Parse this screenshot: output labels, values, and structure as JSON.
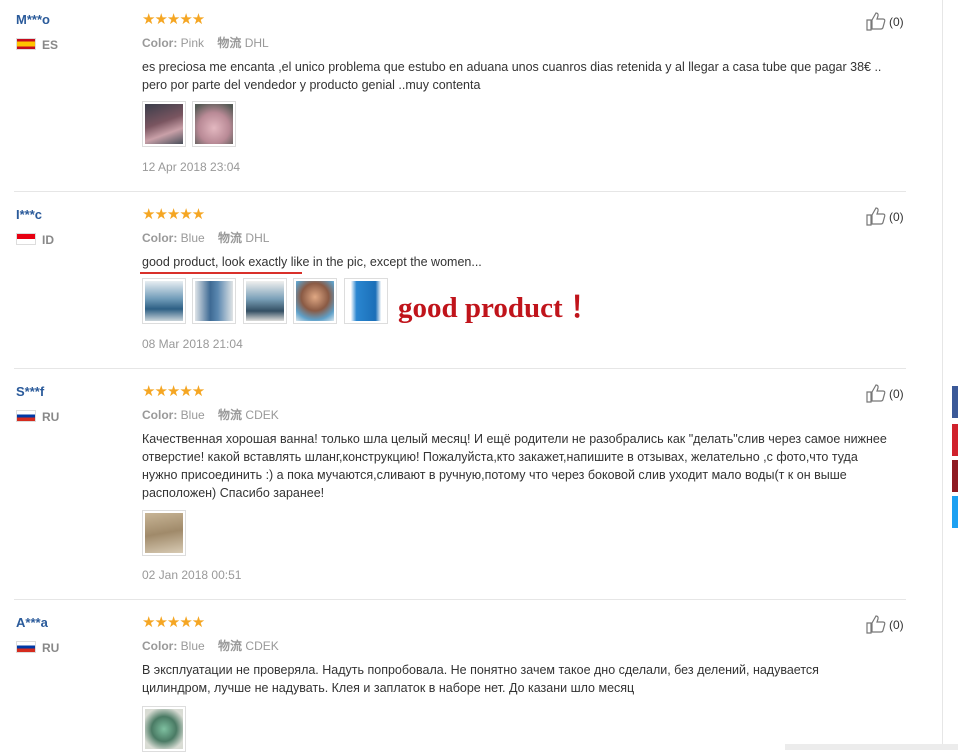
{
  "reviews": [
    {
      "user": "M***o",
      "country": "ES",
      "flag": "es",
      "stars": "★★★★★",
      "color_label": "Color:",
      "color_value": "Pink",
      "logistics_label": "物流",
      "logistics_value": "DHL",
      "text": "es preciosa me encanta ,el unico problema que estubo en aduana unos cuanros dias retenida y al llegar a casa tube que pagar 38€ .. pero por parte del vendedor y producto genial ..muy contenta",
      "helpful_count": "(0)",
      "date": "12 Apr 2018 23:04",
      "photo_count": 2
    },
    {
      "user": "I***c",
      "country": "ID",
      "flag": "id",
      "stars": "★★★★★",
      "color_label": "Color:",
      "color_value": "Blue",
      "logistics_label": "物流",
      "logistics_value": "DHL",
      "text": "good product, look exactly like in the pic, except the women...",
      "helpful_count": "(0)",
      "date": "08 Mar 2018 21:04",
      "photo_count": 5
    },
    {
      "user": "S***f",
      "country": "RU",
      "flag": "ru",
      "stars": "★★★★★",
      "color_label": "Color:",
      "color_value": "Blue",
      "logistics_label": "物流",
      "logistics_value": "CDEK",
      "text": "Качественная хорошая ванна! только шла целый месяц! И ещё родители не разобрались как \"делать\"слив через самое нижнее отверстие! какой вставлять шланг,конструкцию! Пожалуйста,кто закажет,напишите в отзывах, желательно ,с фото,что туда нужно присоединить :) а пока мучаются,сливают в ручную,потому что через боковой слив уходит мало воды(т к он выше расположен) Спасибо заранее!",
      "helpful_count": "(0)",
      "date": "02 Jan 2018 00:51",
      "photo_count": 1
    },
    {
      "user": "A***a",
      "country": "RU",
      "flag": "ru",
      "stars": "★★★★★",
      "color_label": "Color:",
      "color_value": "Blue",
      "logistics_label": "物流",
      "logistics_value": "CDEK",
      "text": "В эксплуатации не проверяла. Надуть попробовала. Не понятно зачем такое дно сделали, без делений, надувается цилиндром, лучше не надувать. Клея и заплаток в наборе нет. До казани шло месяц",
      "helpful_count": "(0)",
      "date": "",
      "photo_count": 1
    }
  ],
  "annotation": {
    "text": "good product ！",
    "color": "#c0141b"
  },
  "colors": {
    "username": "#2a5a9a",
    "stars": "#f5a623",
    "meta": "#999999"
  }
}
